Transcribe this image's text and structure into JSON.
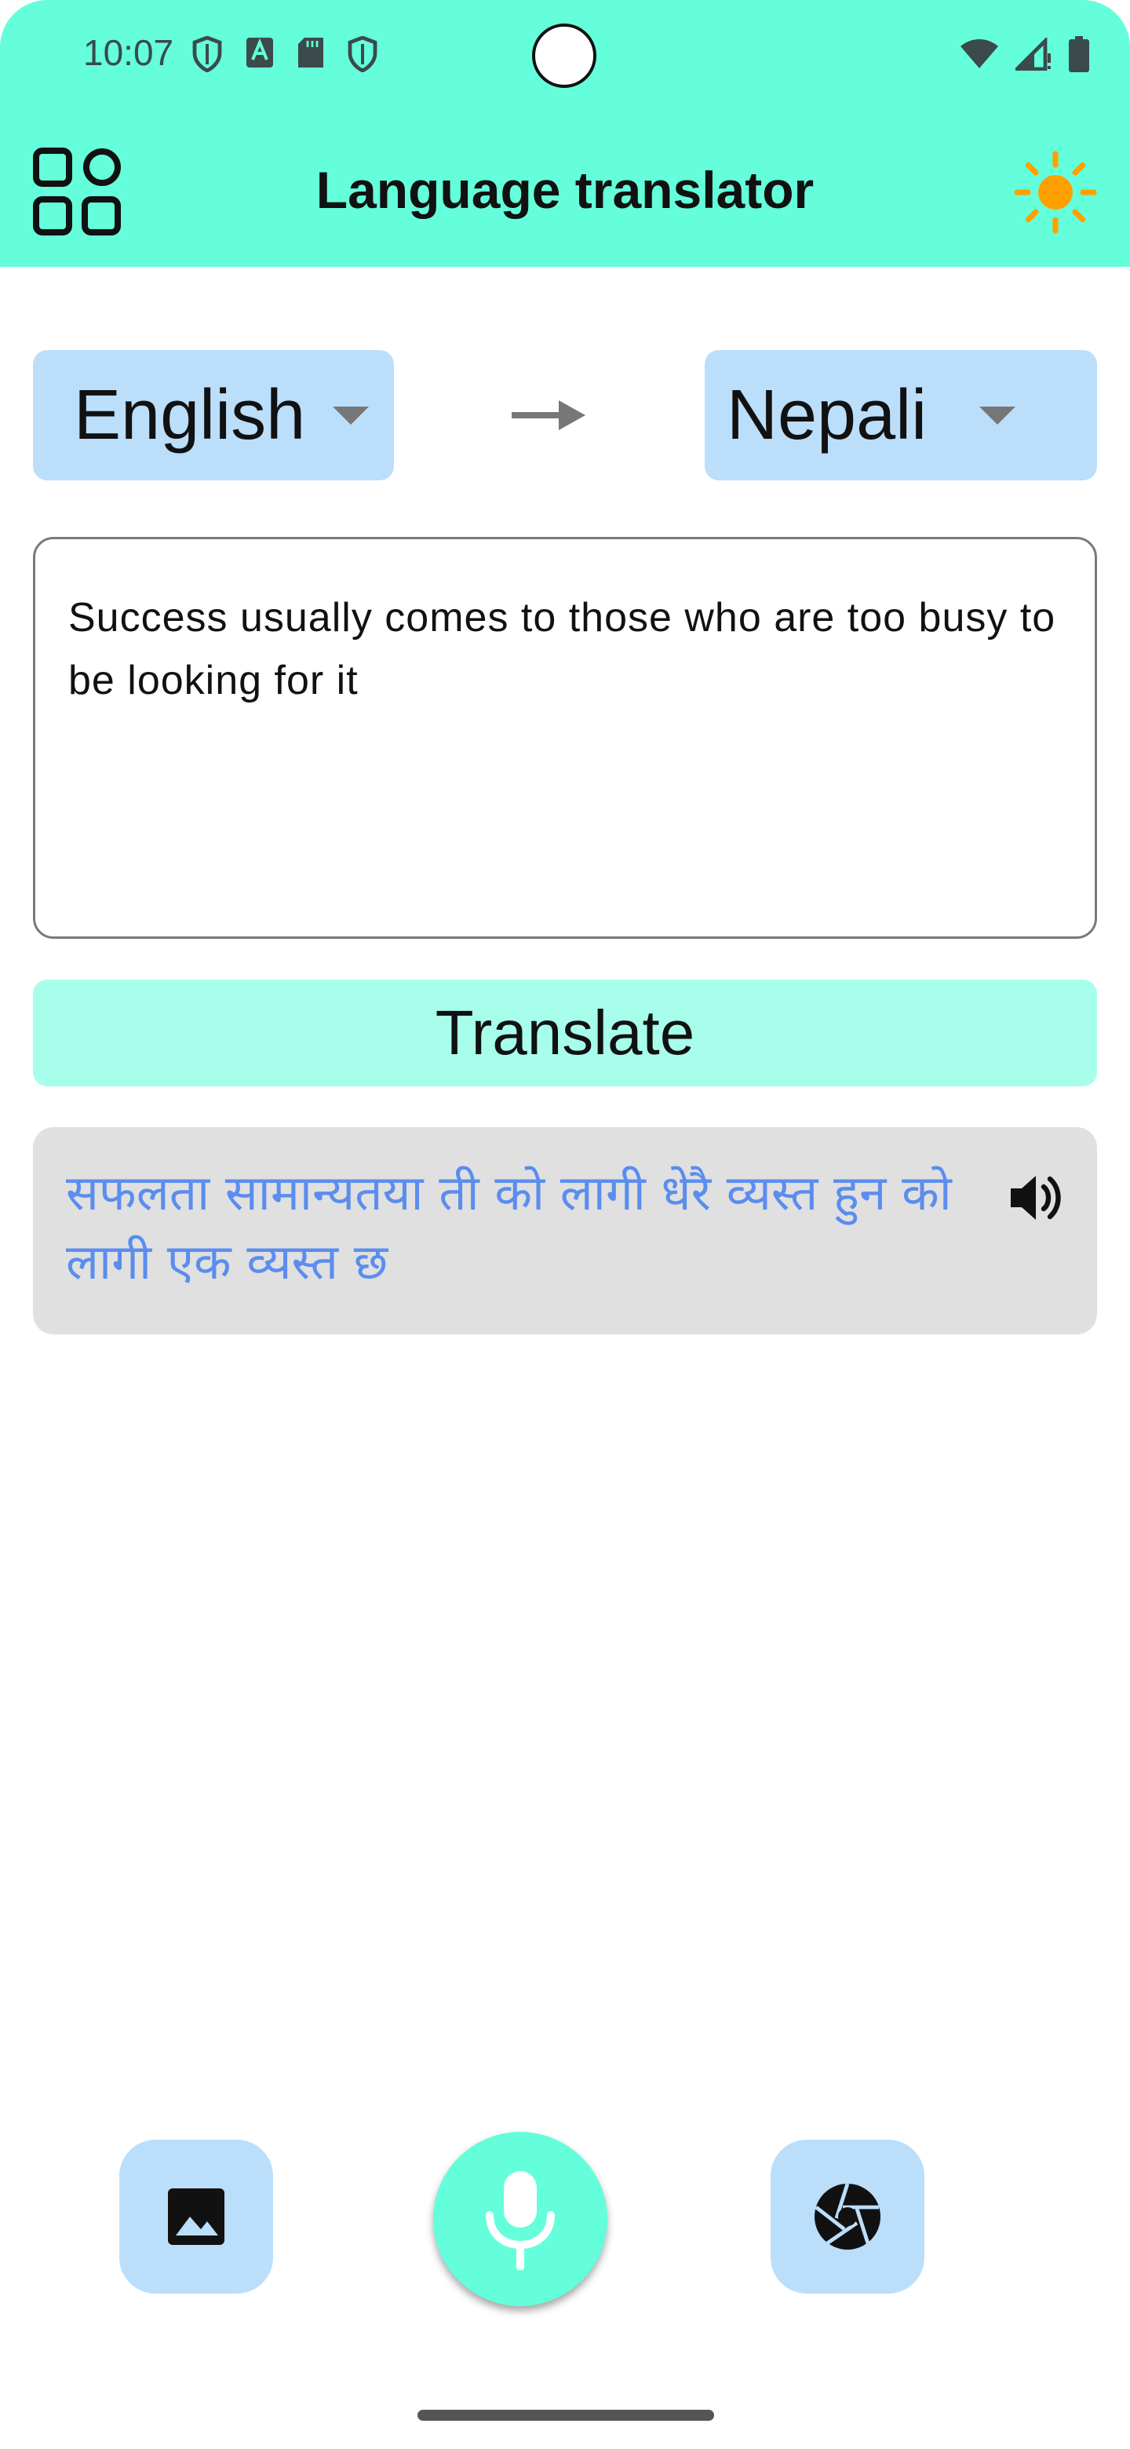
{
  "status_bar": {
    "time": "10:07"
  },
  "app_bar": {
    "title": "Language translator",
    "menu_icon": "grid-apps-icon",
    "theme_icon": "sun-icon"
  },
  "languages": {
    "source": "English",
    "target": "Nepali",
    "swap_icon": "arrow-right-icon"
  },
  "input": {
    "text": "Success usually comes to those who are too busy to be looking for it"
  },
  "translate_button": {
    "label": "Translate"
  },
  "output": {
    "text": "सफलता सामान्यतया ती को लागी धेरै व्यस्त हुन को लागी एक व्यस्त छ",
    "speaker_icon": "speaker-icon"
  },
  "bottom_actions": {
    "gallery_icon": "image-icon",
    "mic_icon": "microphone-icon",
    "camera_icon": "camera-shutter-icon"
  },
  "colors": {
    "accent": "#64FFDA",
    "accent_light": "#A7FFEB",
    "chip_blue": "#BBDEFB",
    "output_bg": "#E0E0E0",
    "output_text": "#5B8DEF",
    "sun": "#FFA000"
  }
}
